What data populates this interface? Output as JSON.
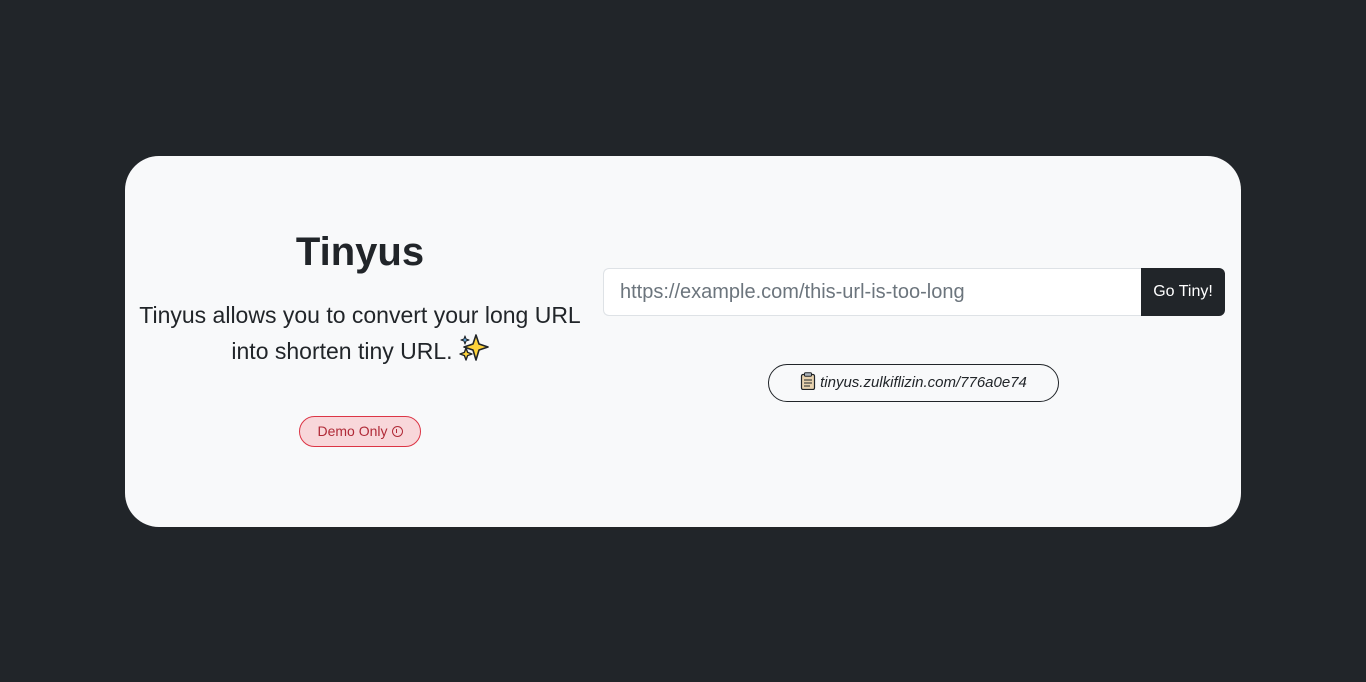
{
  "app": {
    "title": "Tinyus",
    "description": "Tinyus allows you to convert your long URL into shorten tiny URL.",
    "sparkle_icon": "sparkles-icon"
  },
  "badge": {
    "label": "Demo Only",
    "icon": "info-circle-icon",
    "color": "#dc3545"
  },
  "form": {
    "input_placeholder": "https://example.com/this-url-is-too-long",
    "input_value": "",
    "submit_label": "Go Tiny!"
  },
  "result": {
    "icon": "clipboard-icon",
    "short_url": "tinyus.zulkiflizin.com/776a0e74"
  },
  "colors": {
    "background": "#212529",
    "card": "#f8f9fa",
    "accent": "#212529",
    "danger": "#dc3545"
  }
}
